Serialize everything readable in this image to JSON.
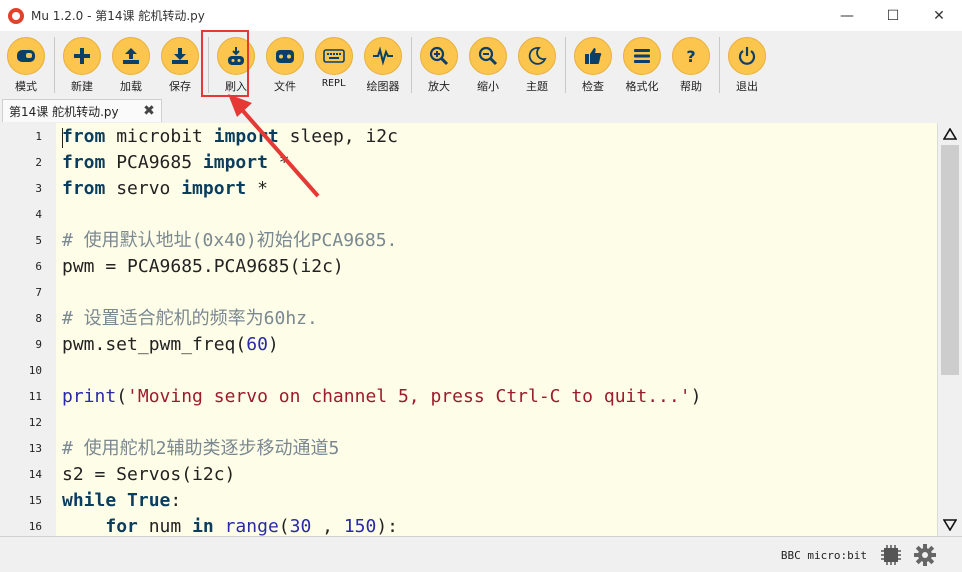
{
  "window": {
    "title": "Mu 1.2.0 - 第14课 舵机转动.py",
    "controls": [
      "minimize",
      "maximize",
      "close"
    ]
  },
  "toolbar": {
    "buttons": [
      {
        "label": "模式",
        "icon": "mode-icon"
      },
      {
        "label": "新建",
        "icon": "new-icon"
      },
      {
        "label": "加载",
        "icon": "load-icon"
      },
      {
        "label": "保存",
        "icon": "save-icon"
      },
      {
        "label": "刷入",
        "icon": "flash-icon"
      },
      {
        "label": "文件",
        "icon": "files-icon"
      },
      {
        "label": "REPL",
        "icon": "keyboard-icon"
      },
      {
        "label": "绘图器",
        "icon": "plotter-icon"
      },
      {
        "label": "放大",
        "icon": "zoom-in-icon"
      },
      {
        "label": "缩小",
        "icon": "zoom-out-icon"
      },
      {
        "label": "主题",
        "icon": "theme-icon"
      },
      {
        "label": "检查",
        "icon": "check-icon"
      },
      {
        "label": "格式化",
        "icon": "tidy-icon"
      },
      {
        "label": "帮助",
        "icon": "help-icon"
      },
      {
        "label": "退出",
        "icon": "quit-icon"
      }
    ]
  },
  "tab": {
    "label": "第14课 舵机转动.py"
  },
  "editor": {
    "line_numbers": [
      "1",
      "2",
      "3",
      "4",
      "5",
      "6",
      "7",
      "8",
      "9",
      "10",
      "11",
      "12",
      "13",
      "14",
      "15",
      "16"
    ]
  },
  "status": {
    "mode": "BBC micro:bit"
  },
  "colors": {
    "button_fill": "#fcc54e",
    "highlight_box": "#e53935",
    "editor_bg": "#fefee8"
  }
}
